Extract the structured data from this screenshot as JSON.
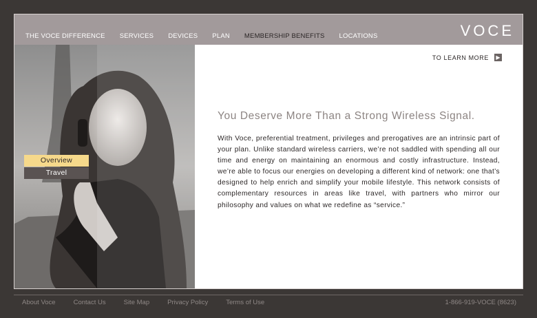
{
  "header": {
    "logo": "VOCE",
    "nav": [
      {
        "label": "THE VOCE DIFFERENCE",
        "active": false
      },
      {
        "label": "SERVICES",
        "active": false
      },
      {
        "label": "DEVICES",
        "active": false
      },
      {
        "label": "PLAN",
        "active": false
      },
      {
        "label": "MEMBERSHIP BENEFITS",
        "active": true
      },
      {
        "label": "LOCATIONS",
        "active": false
      }
    ]
  },
  "subnav": {
    "items": [
      {
        "label": "Overview",
        "selected": true
      },
      {
        "label": "Travel",
        "selected": false
      }
    ]
  },
  "cta": {
    "label": "TO LEARN MORE",
    "icon": "arrow-right-icon"
  },
  "content": {
    "headline": "You Deserve More Than a Strong Wireless Signal.",
    "body": "With Voce, preferential treatment, privileges and prerogatives are an intrinsic part of your plan.  Unlike standard wireless carriers, we’re not saddled with spending all our time and energy on maintaining an enormous and costly infrastructure.  Instead, we’re able to focus our energies on developing a different kind of network: one that’s designed to help enrich and simplify your mobile lifestyle.  This network consists of complementary resources in areas like travel, with partners who mirror our philosophy and values on what we redefine as “service.”"
  },
  "footer": {
    "links": [
      "About Voce",
      "Contact Us",
      "Site Map",
      "Privacy Policy",
      "Terms of Use"
    ],
    "phone": "1-866-919-VOCE (8623)"
  },
  "colors": {
    "background": "#3b3735",
    "header_bar": "#a29a9b",
    "selected_subnav": "#f6d98b",
    "headline": "#8c8482"
  }
}
